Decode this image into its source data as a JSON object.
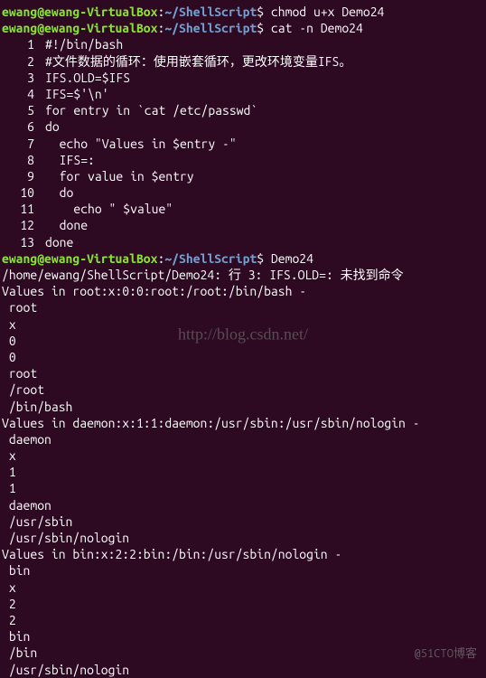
{
  "prompt": {
    "user_host": "ewang@ewang-VirtualBox",
    "separator": ":",
    "path": "~/ShellScript",
    "dollar": "$"
  },
  "commands": {
    "cmd1": "chmod u+x Demo24",
    "cmd2": "cat -n Demo24",
    "cmd3": "Demo24"
  },
  "script_lines": [
    {
      "num": "1",
      "code": "#!/bin/bash"
    },
    {
      "num": "2",
      "code": "#文件数据的循环：使用嵌套循环，更改环境变量IFS。"
    },
    {
      "num": "3",
      "code": "IFS.OLD=$IFS"
    },
    {
      "num": "4",
      "code": "IFS=$'\\n'"
    },
    {
      "num": "5",
      "code": "for entry in `cat /etc/passwd`"
    },
    {
      "num": "6",
      "code": "do"
    },
    {
      "num": "7",
      "code": "  echo \"Values in $entry -\""
    },
    {
      "num": "8",
      "code": "  IFS=:"
    },
    {
      "num": "9",
      "code": "  for value in $entry"
    },
    {
      "num": "10",
      "code": "  do"
    },
    {
      "num": "11",
      "code": "    echo \" $value\""
    },
    {
      "num": "12",
      "code": "  done"
    },
    {
      "num": "13",
      "code": "done"
    }
  ],
  "output": {
    "error_line": "/home/ewang/ShellScript/Demo24: 行 3: IFS.OLD=: 未找到命令",
    "entries": [
      {
        "header": "Values in root:x:0:0:root:/root:/bin/bash -",
        "values": [
          " root",
          " x",
          " 0",
          " 0",
          " root",
          " /root",
          " /bin/bash"
        ]
      },
      {
        "header": "Values in daemon:x:1:1:daemon:/usr/sbin:/usr/sbin/nologin -",
        "values": [
          " daemon",
          " x",
          " 1",
          " 1",
          " daemon",
          " /usr/sbin",
          " /usr/sbin/nologin"
        ]
      },
      {
        "header": "Values in bin:x:2:2:bin:/bin:/usr/sbin/nologin -",
        "values": [
          " bin",
          " x",
          " 2",
          " 2",
          " bin",
          " /bin",
          " /usr/sbin/nologin"
        ]
      }
    ]
  },
  "watermarks": {
    "center": "http://blog.csdn.net/",
    "bottom": "@51CTO博客"
  }
}
